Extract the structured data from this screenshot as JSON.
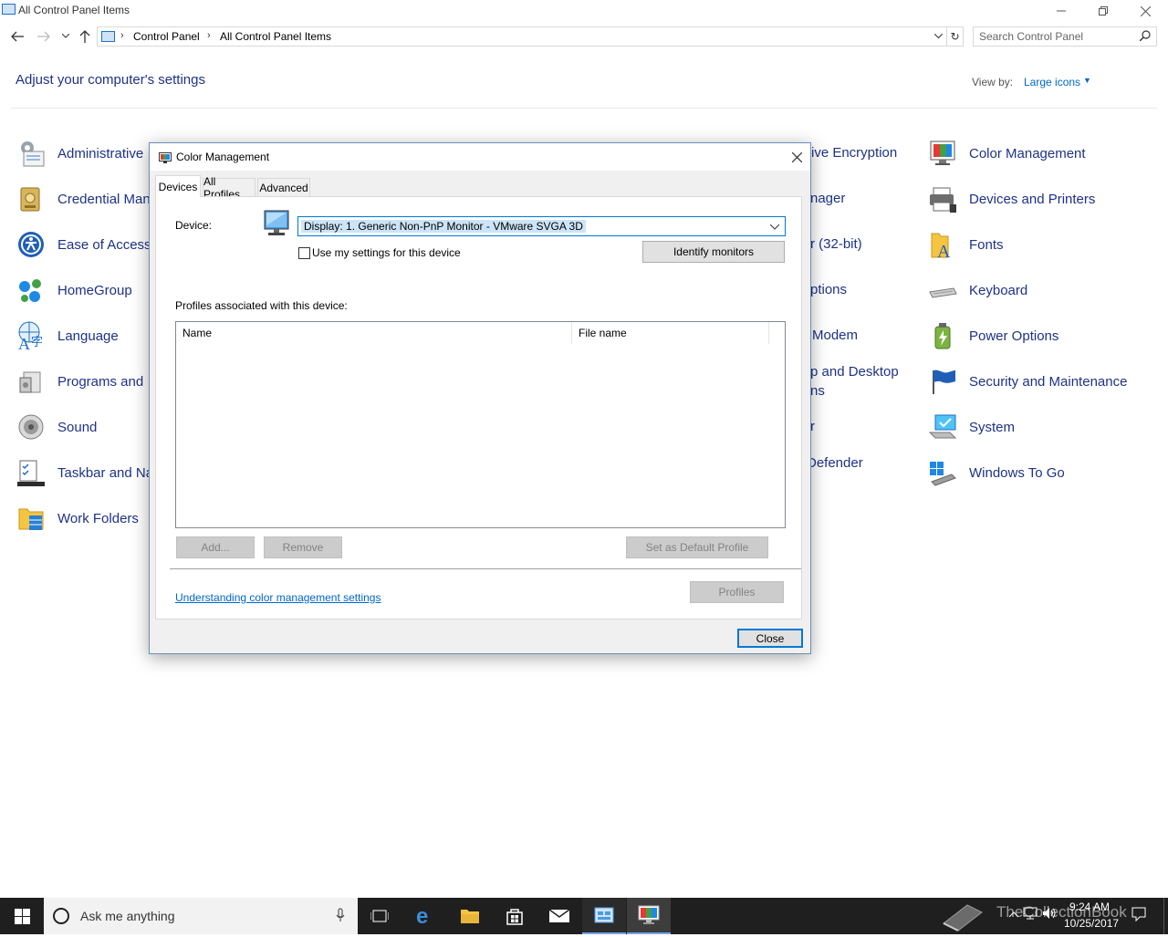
{
  "window": {
    "title": "All Control Panel Items",
    "minimize_icon": "minimize-icon",
    "restore_icon": "restore-icon",
    "close_icon": "close-icon"
  },
  "navigation": {
    "back_icon": "back-arrow-icon",
    "forward_icon": "forward-arrow-icon",
    "recent_icon": "chevron-down-icon",
    "up_icon": "up-arrow-icon",
    "breadcrumb": [
      "Control Panel",
      "All Control Panel Items"
    ],
    "search_placeholder": "Search Control Panel"
  },
  "header": {
    "title": "Adjust your computer's settings",
    "view_by_label": "View by:",
    "view_by_value": "Large icons"
  },
  "items": {
    "col1": [
      {
        "label": "Administrative",
        "icon": "administrative-tools-icon"
      },
      {
        "label": "Credential Man",
        "icon": "credential-manager-icon"
      },
      {
        "label": "Ease of Access",
        "icon": "ease-of-access-icon"
      },
      {
        "label": "HomeGroup",
        "icon": "homegroup-icon"
      },
      {
        "label": "Language",
        "icon": "language-icon"
      },
      {
        "label": "Programs and",
        "icon": "programs-icon"
      },
      {
        "label": "Sound",
        "icon": "sound-icon"
      },
      {
        "label": "Taskbar and Na",
        "icon": "taskbar-icon"
      },
      {
        "label": "Work Folders",
        "icon": "work-folders-icon"
      }
    ],
    "col3_partial": [
      "rive Encryption",
      "nager",
      "r (32-bit)",
      "ptions",
      "Modem",
      "p and Desktop",
      "ns",
      "r",
      "Defender"
    ],
    "col4": [
      {
        "label": "Color Management",
        "icon": "color-management-icon"
      },
      {
        "label": "Devices and Printers",
        "icon": "printer-icon"
      },
      {
        "label": "Fonts",
        "icon": "fonts-icon"
      },
      {
        "label": "Keyboard",
        "icon": "keyboard-icon"
      },
      {
        "label": "Power Options",
        "icon": "power-options-icon"
      },
      {
        "label": "Security and Maintenance",
        "icon": "flag-icon"
      },
      {
        "label": "System",
        "icon": "system-icon"
      },
      {
        "label": "Windows To Go",
        "icon": "windows-to-go-icon"
      }
    ]
  },
  "dialog": {
    "title": "Color Management",
    "tabs": [
      "Devices",
      "All Profiles",
      "Advanced"
    ],
    "active_tab": "Devices",
    "device_label": "Device:",
    "device_value": "Display: 1. Generic Non-PnP Monitor - VMware SVGA 3D",
    "use_my_settings_label": "Use my settings for this device",
    "use_my_settings_checked": false,
    "identify_button": "Identify monitors",
    "profiles_label": "Profiles associated with this device:",
    "columns": [
      "Name",
      "File name"
    ],
    "rows": [],
    "add_button": "Add...",
    "remove_button": "Remove",
    "set_default_button": "Set as Default Profile",
    "profiles_button": "Profiles",
    "help_link": "Understanding color management settings",
    "close_button": "Close"
  },
  "taskbar": {
    "search_placeholder": "Ask me anything",
    "apps": [
      "task-view-icon",
      "edge-icon",
      "file-explorer-icon",
      "store-icon",
      "mail-icon",
      "control-panel-icon",
      "color-management-icon"
    ],
    "time": "9:24 AM",
    "date": "10/25/2017",
    "watermark": "TheCollectionBook"
  },
  "colors": {
    "link_blue": "#1e3287",
    "accent": "#0078d7",
    "taskbar_bg": "#1f1f1f"
  }
}
